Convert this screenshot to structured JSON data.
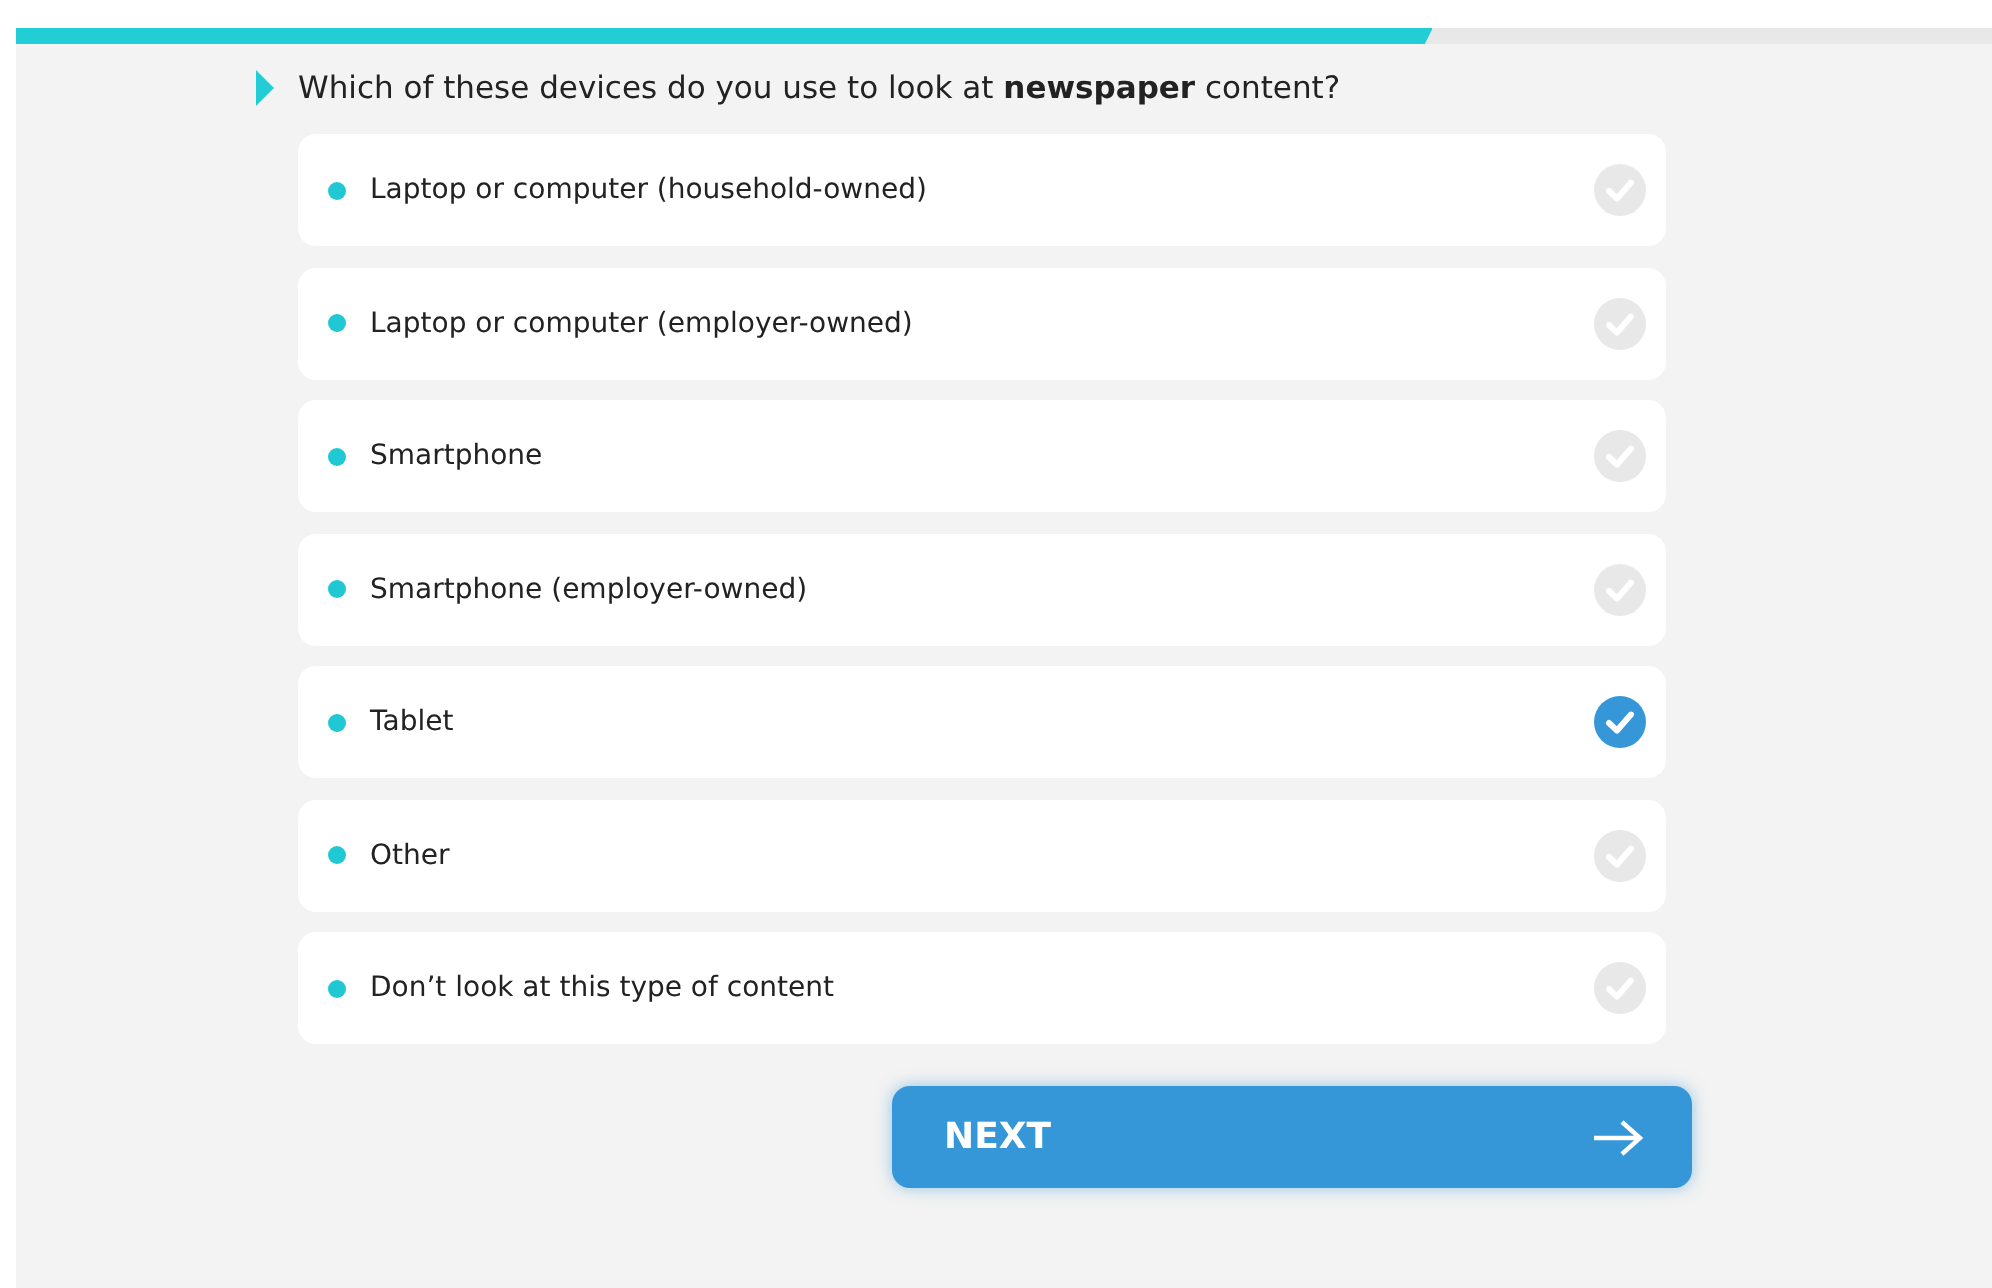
{
  "progress": {
    "level": 0.717
  },
  "question": "Which of these devices do you use to look at **newspaper** content?",
  "options": [
    {
      "label": "Laptop or computer (household-owned)",
      "selected": false
    },
    {
      "label": "Laptop or computer (employer-owned)",
      "selected": false
    },
    {
      "label": "Smartphone",
      "selected": false
    },
    {
      "label": "Smartphone (employer-owned)",
      "selected": false
    },
    {
      "label": "Tablet",
      "selected": true
    },
    {
      "label": "Other",
      "selected": false
    },
    {
      "label": "Don’t look at this type of content",
      "selected": false
    }
  ],
  "next_button": {
    "label": "NEXT"
  }
}
